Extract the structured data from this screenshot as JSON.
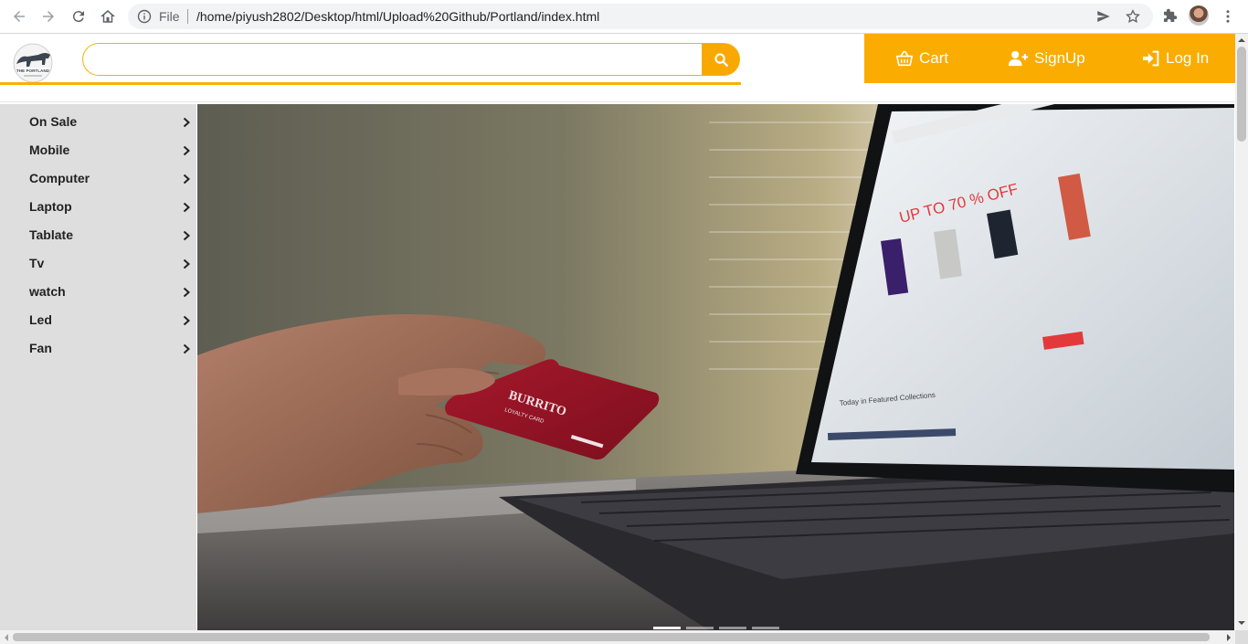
{
  "browser": {
    "scheme_label": "File",
    "url": "/home/piyush2802/Desktop/html/Upload%20Github/Portland/index.html",
    "icons": [
      "back-icon",
      "forward-icon",
      "reload-icon",
      "home-icon",
      "info-icon",
      "send-icon",
      "star-icon",
      "extensions-icon",
      "avatar",
      "menu-icon"
    ]
  },
  "header": {
    "logo_text": "THE PORTLAND",
    "search": {
      "value": "",
      "placeholder": ""
    },
    "cart_label": "Cart",
    "signup_label": "SignUp",
    "login_label": "Log In",
    "accent_color": "#fbac00"
  },
  "sidebar": {
    "items": [
      {
        "label": "On Sale"
      },
      {
        "label": "Mobile"
      },
      {
        "label": "Computer"
      },
      {
        "label": "Laptop"
      },
      {
        "label": "Tablate"
      },
      {
        "label": "Tv"
      },
      {
        "label": "watch"
      },
      {
        "label": "Led"
      },
      {
        "label": "Fan"
      }
    ]
  },
  "hero": {
    "card_brand": "BURRITO",
    "card_subtitle": "LOYALTY CARD",
    "screen_promo": "UP TO 70 % OFF",
    "screen_caption": "Today in Featured Collections",
    "carousel": {
      "slide_count": 4,
      "active_index": 0
    }
  }
}
